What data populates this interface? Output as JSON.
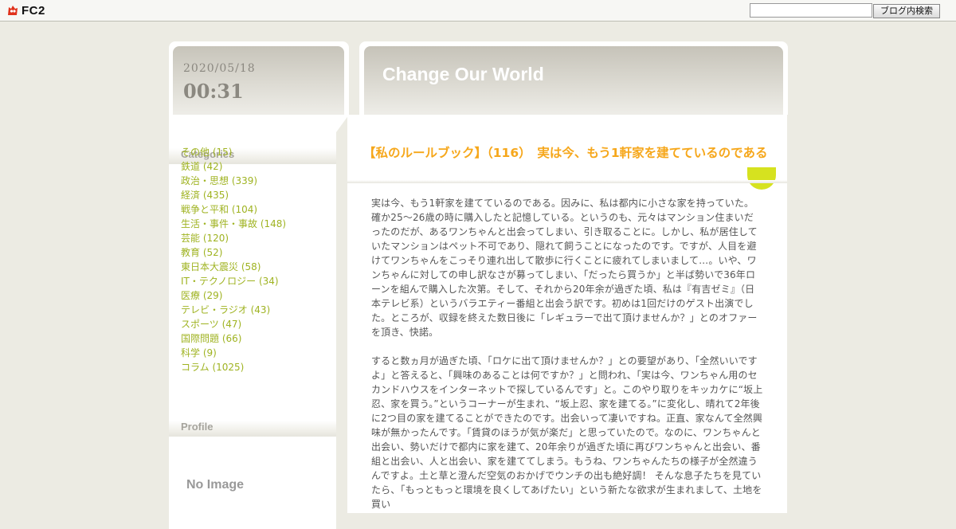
{
  "topbar": {
    "logo_text": "FC2",
    "search_placeholder": "",
    "search_button": "ブログ内検索"
  },
  "date": {
    "ymd": "2020/05/18",
    "time": "00:31"
  },
  "blog": {
    "title": "Change Our World"
  },
  "sidebar": {
    "categories_heading": "Categories",
    "categories": [
      {
        "label": "その他 (15)"
      },
      {
        "label": "鉄道 (42)"
      },
      {
        "label": "政治・思想 (339)"
      },
      {
        "label": "経済 (435)"
      },
      {
        "label": "戦争と平和 (104)"
      },
      {
        "label": "生活・事件・事故 (148)"
      },
      {
        "label": "芸能 (120)"
      },
      {
        "label": "教育 (52)"
      },
      {
        "label": "東日本大震災 (58)"
      },
      {
        "label": "IT・テクノロジー (34)"
      },
      {
        "label": "医療 (29)"
      },
      {
        "label": "テレビ・ラジオ (43)"
      },
      {
        "label": "スポーツ (47)"
      },
      {
        "label": "国際問題 (66)"
      },
      {
        "label": "科学 (9)"
      },
      {
        "label": "コラム (1025)"
      }
    ],
    "profile_heading": "Profile",
    "no_image_text": "No Image"
  },
  "entry": {
    "title": "【私のルールブック】（116）　実は今、もう1軒家を建てているのである",
    "paragraphs": [
      "実は今、もう1軒家を建てているのである。因みに、私は都内に小さな家を持っていた。確か25～26歳の時に購入したと記憶している。というのも、元々はマンション住まいだったのだが、あるワンちゃんと出会ってしまい、引き取ることに。しかし、私が居住していたマンションはペット不可であり、隠れて飼うことになったのです。ですが、人目を避けてワンちゃんをこっそり連れ出して散歩に行くことに疲れてしまいまして…。いや、ワンちゃんに対しての申し訳なさが募ってしまい、「だったら買うか」と半ば勢いで36年ローンを組んで購入した次第。そして、それから20年余が過ぎた頃、私は『有吉ゼミ』（日本テレビ系）というバラエティー番組と出会う訳です。初めは1回だけのゲスト出演でした。ところが、収録を終えた数日後に「レギュラーで出て頂けませんか？」とのオファーを頂き、快諾。",
      "すると数ヵ月が過ぎた頃、「ロケに出て頂けませんか？」との要望があり、「全然いいですよ」と答えると、「興味のあることは何ですか？」と問われ、「実は今、ワンちゃん用のセカンドハウスをインターネットで探しているんです」と。このやり取りをキッカケに“坂上忍、家を買う。”というコーナーが生まれ、“坂上忍、家を建てる。”に変化し、晴れて2年後に2つ目の家を建てることができたのです。出会いって凄いですね。正直、家なんて全然興味が無かったんです。「賃貸のほうが気が楽だ」と思っていたので。なのに、ワンちゃんと出会い、勢いだけで都内に家を建て、20年余りが過ぎた頃に再びワンちゃんと出会い、番組と出会い、人と出会い、家を建ててしまう。もうね、ワンちゃんたちの様子が全然違うんですよ。土と草と澄んだ空気のおかげでウンチの出も絶好調！ そんな息子たちを見ていたら、「もっともっと環境を良くしてあげたい」という新たな欲求が生まれまして、土地を買い"
    ]
  },
  "colors": {
    "accent_orange": "#f6a71b",
    "link_green": "#9fb321",
    "page_bg": "#ecebe3"
  }
}
